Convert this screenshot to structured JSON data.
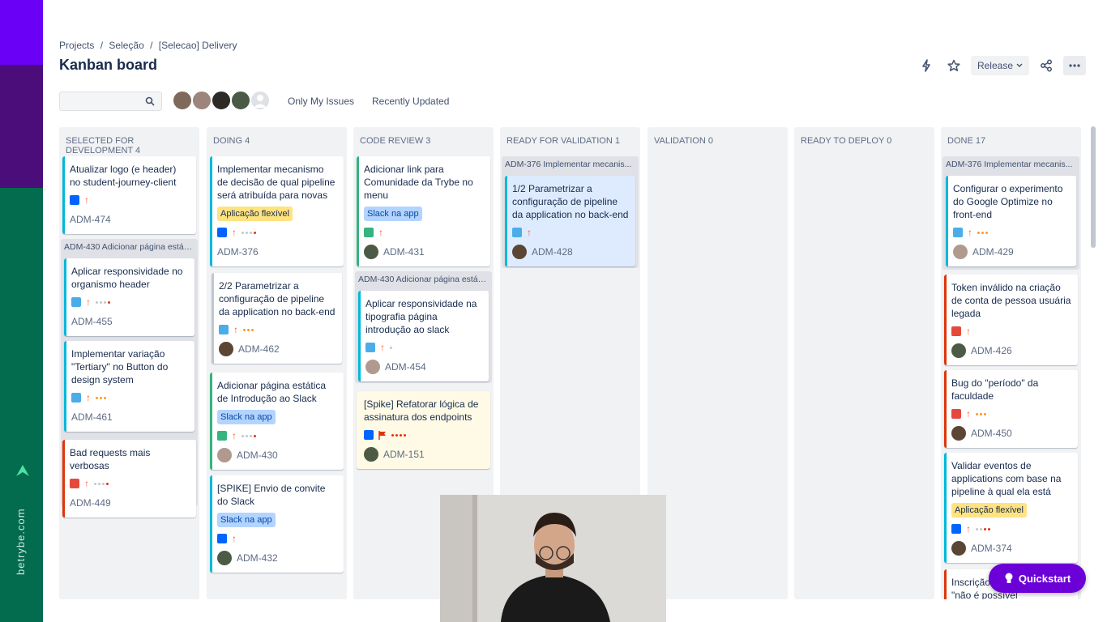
{
  "brand": {
    "url": "betrybe.com"
  },
  "breadcrumb": [
    "Projects",
    "/",
    "Seleção",
    "/",
    "[Selecao] Delivery"
  ],
  "page_title": "Kanban board",
  "actions": {
    "release_label": "Release"
  },
  "filters": {
    "only_my_issues": "Only My Issues",
    "recently_updated": "Recently Updated"
  },
  "columns": [
    {
      "title": "SELECTED FOR DEVELOPMENT",
      "count": "4"
    },
    {
      "title": "DOING",
      "count": "4"
    },
    {
      "title": "CODE REVIEW",
      "count": "3"
    },
    {
      "title": "READY FOR VALIDATION",
      "count": "1"
    },
    {
      "title": "VALIDATION",
      "count": "0"
    },
    {
      "title": "READY TO DEPLOY",
      "count": "0"
    },
    {
      "title": "DONE",
      "count": "17"
    }
  ],
  "cards": {
    "c1a": {
      "summary": "Atualizar logo (e header) no student-journey-client",
      "key": "ADM-474"
    },
    "g1": {
      "title": "ADM-430 Adicionar página estáti..."
    },
    "c1b": {
      "summary": "Aplicar responsividade no organismo header",
      "key": "ADM-455"
    },
    "c1c": {
      "summary": "Implementar variação \"Tertiary\" no Button do design system",
      "key": "ADM-461"
    },
    "c1d": {
      "summary": "Bad requests mais verbosas",
      "key": "ADM-449"
    },
    "c2a": {
      "summary": "Implementar mecanismo de decisão de qual pipeline será atribuída para novas",
      "epic": "Aplicação flexível",
      "key": "ADM-376"
    },
    "c2b": {
      "summary": "2/2 Parametrizar a configuração de pipeline da application no back-end",
      "key": "ADM-462"
    },
    "c2c": {
      "summary": "Adicionar página estática de Introdução ao Slack",
      "epic": "Slack na app",
      "key": "ADM-430"
    },
    "c2d": {
      "summary": "[SPIKE] Envio de convite do Slack",
      "epic": "Slack na app",
      "key": "ADM-432"
    },
    "c3a": {
      "summary": "Adicionar link para Comunidade da Trybe no menu",
      "epic": "Slack na app",
      "key": "ADM-431"
    },
    "g3": {
      "title": "ADM-430 Adicionar página estáti..."
    },
    "c3b": {
      "summary": "Aplicar responsividade na tipografia página introdução ao slack",
      "key": "ADM-454"
    },
    "c3c": {
      "summary": "[Spike] Refatorar lógica de assinatura dos endpoints",
      "key": "ADM-151"
    },
    "g4": {
      "title": "ADM-376 Implementar mecanis..."
    },
    "c4a": {
      "summary": "1/2 Parametrizar a configuração de pipeline da application no back-end",
      "key": "ADM-428"
    },
    "g7": {
      "title": "ADM-376 Implementar mecanis..."
    },
    "c7a": {
      "summary": "Configurar o experimento do Google Optimize no front-end",
      "key": "ADM-429"
    },
    "c7b": {
      "summary": "Token inválido na criação de conta de pessoa usuária legada",
      "key": "ADM-426"
    },
    "c7c": {
      "summary": "Bug do \"período\" da faculdade",
      "key": "ADM-450"
    },
    "c7d": {
      "summary": "Validar eventos de applications com base na pipeline à qual ela está",
      "epic": "Aplicação flexível",
      "key": "ADM-374"
    },
    "c7e": {
      "summary": "Inscrição ... Informações \"não é possível"
    }
  },
  "quickstart": {
    "label": "Quickstart"
  }
}
